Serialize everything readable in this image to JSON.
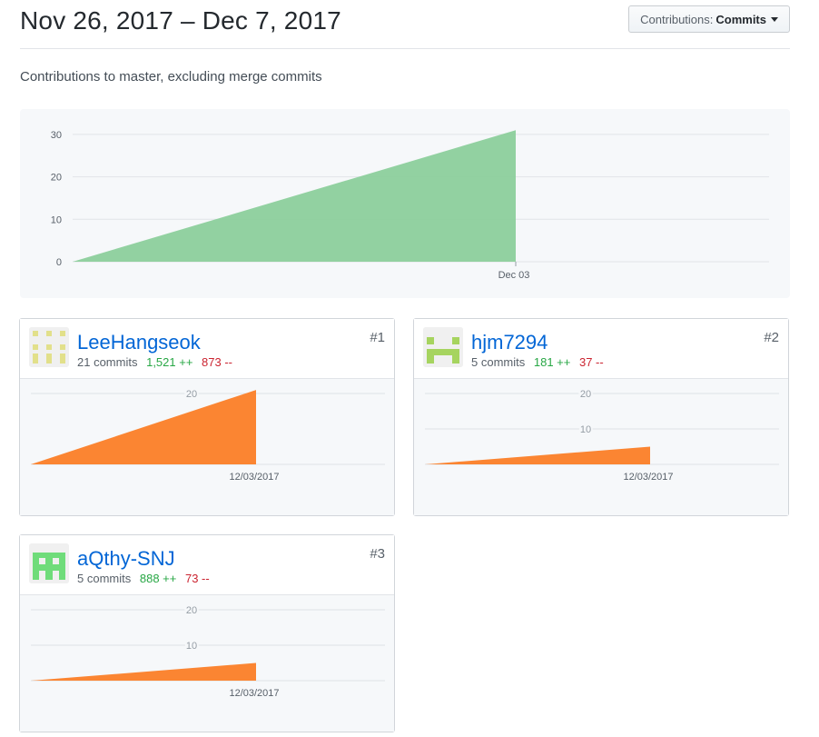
{
  "header": {
    "title": "Nov 26, 2017 – Dec 7, 2017",
    "contributions_label": "Contributions:",
    "contributions_value": "Commits"
  },
  "subtitle": "Contributions to master, excluding merge commits",
  "colors": {
    "overall_area": "#8ccf9c",
    "user_area": "#fb8532",
    "link": "#0366d6",
    "additions": "#28a745",
    "deletions": "#cb2431"
  },
  "chart_data": [
    {
      "type": "area",
      "x": [
        "2017-11-26",
        "2017-12-03"
      ],
      "values": [
        0,
        31
      ],
      "ylim": [
        0,
        30
      ],
      "yticks": [
        0,
        10,
        20,
        30
      ],
      "xtick_labels": [
        "Dec 03"
      ],
      "grid": true
    },
    {
      "type": "area",
      "x": [
        "2017-11-26",
        "2017-12-03"
      ],
      "values": [
        0,
        21
      ],
      "yticks": [
        20
      ],
      "xtick_labels": [
        "12/03/2017"
      ],
      "grid": true
    },
    {
      "type": "area",
      "x": [
        "2017-11-26",
        "2017-12-03"
      ],
      "values": [
        0,
        5
      ],
      "yticks": [
        10,
        20
      ],
      "xtick_labels": [
        "12/03/2017"
      ],
      "grid": true
    },
    {
      "type": "area",
      "x": [
        "2017-11-26",
        "2017-12-03"
      ],
      "values": [
        0,
        5
      ],
      "yticks": [
        10,
        20
      ],
      "xtick_labels": [
        "12/03/2017"
      ],
      "grid": true
    }
  ],
  "contributors": [
    {
      "rank": "#1",
      "name": "LeeHangseok",
      "commits": "21 commits",
      "additions": "1,521 ++",
      "deletions": "873 --",
      "avatar_color": "#e2e08a"
    },
    {
      "rank": "#2",
      "name": "hjm7294",
      "commits": "5 commits",
      "additions": "181 ++",
      "deletions": "37 --",
      "avatar_color": "#a6d45f"
    },
    {
      "rank": "#3",
      "name": "aQthy-SNJ",
      "commits": "5 commits",
      "additions": "888 ++",
      "deletions": "73 --",
      "avatar_color": "#6fdc7a"
    }
  ]
}
